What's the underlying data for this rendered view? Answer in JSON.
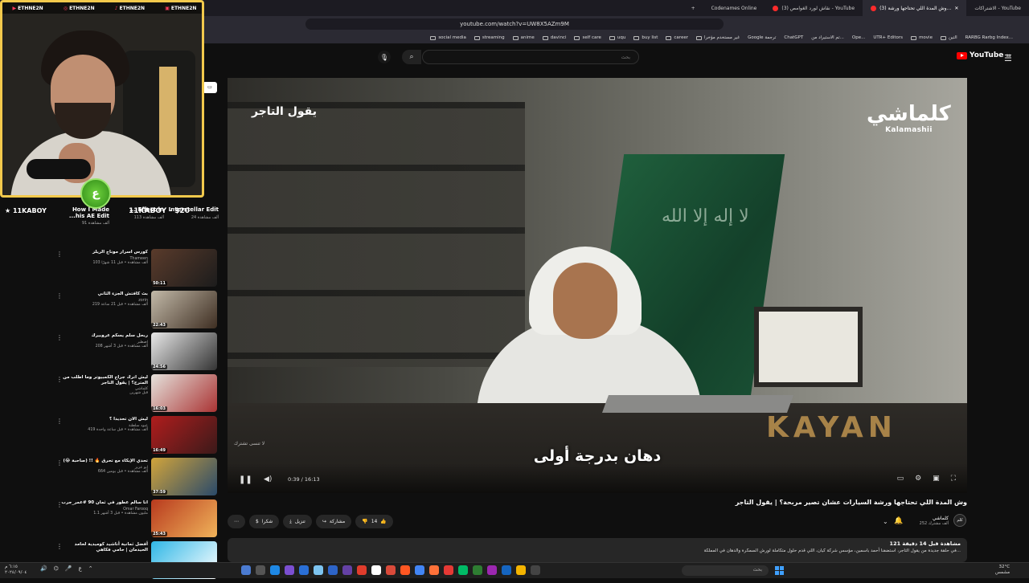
{
  "browser": {
    "tabs": [
      {
        "label": "الاشتراكات - YouTube"
      },
      {
        "label": "(3) وش المدة اللي تحتاجها ورشة...",
        "active": true
      },
      {
        "label": "(3) نقاش لورد الغوامص - YouTube"
      },
      {
        "label": "Codenames Online"
      }
    ],
    "url": "youtube.com/watch?v=UW8X5AZm9M",
    "bookmarks": [
      "social media",
      "streaming",
      "anime",
      "davinci",
      "self care",
      "uqu",
      "buy list",
      "career",
      "غير مستخدم مؤخرا",
      "Google ترجمة",
      "ChatGPT",
      "تم الاستيراد من...",
      "Ope...",
      "UTR+ Editors",
      "movie",
      "التين",
      "RARBG Rarbg Index..."
    ]
  },
  "youtube": {
    "logo": "YouTube",
    "logo_region": "SA",
    "search_placeholder": "بحث",
    "search_value": "",
    "search_icon": "search-icon",
    "mic_icon": "mic-icon"
  },
  "player": {
    "brand_ar": "كلماشي",
    "brand_en": "Kalamashii",
    "top_caption": "يقول التاجر",
    "subtitle": "دهان بدرجة أولى",
    "watermark": "لا تنسى تشترك",
    "time": "0:39 / 16:13",
    "progress": 0.04,
    "flag_text": "لا إله إلا الله"
  },
  "video": {
    "title": "وش المدة اللي تحتاجها ورشة السيارات عشان تصير مربحة؟ | يقول التاجر",
    "channel": "كلماشي",
    "subscribers": "252 ألف مشترك",
    "likes": "14",
    "share_label": "مشاركة",
    "download_label": "تنزيل",
    "thanks_label": "شكرا",
    "desc_line1": "121 مشاهدة قبل 14 دقيقة",
    "desc_line2": "في حلقة جديدة من يقول التاجر، استضفنا أحمد باسمين، مؤسس شركة كيان، اللي قدم حلول متكاملة لورش السمكرة والدهان في المملكة..."
  },
  "overlay": {
    "socials": [
      "ETHNE2N",
      "ETHNE2N",
      "ETHNE2N",
      "ETHNE2N"
    ],
    "badge": "ع",
    "kaboy": "11KABOY",
    "kaboy2": "11KABOY - $20"
  },
  "shorts": [
    {
      "title": "How I Made ...his AE Edit",
      "views": "91 ألف مشاهدة"
    },
    {
      "title": "... Effect in",
      "views": "113 ألف مشاهدة"
    },
    {
      "title": "Interstellar Edit",
      "views": "24 ألف مشاهدة"
    }
  ],
  "related": [
    {
      "title": "كورس اسرار موناج الريلز",
      "channel": "Thameen",
      "views": "103 ألف مشاهدة • قبل 11 شهرًا",
      "duration": "50:11",
      "c1": "#5a3b2b",
      "c2": "#1c1c1c"
    },
    {
      "title": "بث كافتش الجزء الثاني",
      "channel": "zorin",
      "views": "219 ألف مشاهدة • قبل 21 ساعة",
      "duration": "22:43",
      "c1": "#c2b9a8",
      "c2": "#3e2e22"
    },
    {
      "title": "ربحل سلم يسكم عروبيرك",
      "channel": "اصطبر",
      "views": "208 ألف مشاهدة • قبل 3 أشهر",
      "duration": "24:56",
      "c1": "#e8e8e8",
      "c2": "#333"
    },
    {
      "title": "ليش اترك جراج الكمبيوتر وما اطلب من المترح؟ | يقول التاجر",
      "channel": "كلماشي",
      "views": "قبل شهرين",
      "duration": "16:03",
      "c1": "#e5e2dc",
      "c2": "#a33"
    },
    {
      "title": "ليش الان تحديدا ؟",
      "channel": "عبود سلطنة",
      "views": "419 ألف مشاهدة • قبل ساعة واحدة",
      "duration": "16:49",
      "c1": "#b01d1d",
      "c2": "#3b1a1a"
    },
    {
      "title": "تحدي الإيكاء مع تحرق 🔥 !! (صاحبة 😂)",
      "channel": "ابو عزيز",
      "views": "664 ألف مشاهدة • قبل يومين",
      "duration": "37:59",
      "c1": "#d1a43b",
      "c2": "#2a4a6a"
    },
    {
      "title": "انا سالم عطور في ثمان 90 #عمر_جرب",
      "channel": "Omar Farooq",
      "views": "1.1 مليون مشاهدة • قبل 3 أشهر",
      "duration": "25:43",
      "c1": "#b83a1e",
      "c2": "#f0b35a"
    },
    {
      "title": "أفضل ثمانية أناشيد كوميدية لحامد الحيدمان | حامي فكاهي",
      "channel": "",
      "views": "",
      "duration": "",
      "c1": "#2fb7e6",
      "c2": "#ffffff"
    }
  ],
  "taskbar": {
    "search_placeholder": "بحث",
    "weather_temp": "32°C",
    "weather_desc": "مشمس",
    "time": "٦:١٥ م",
    "date": "٢٠٢٤/٠٩/٠٤"
  }
}
